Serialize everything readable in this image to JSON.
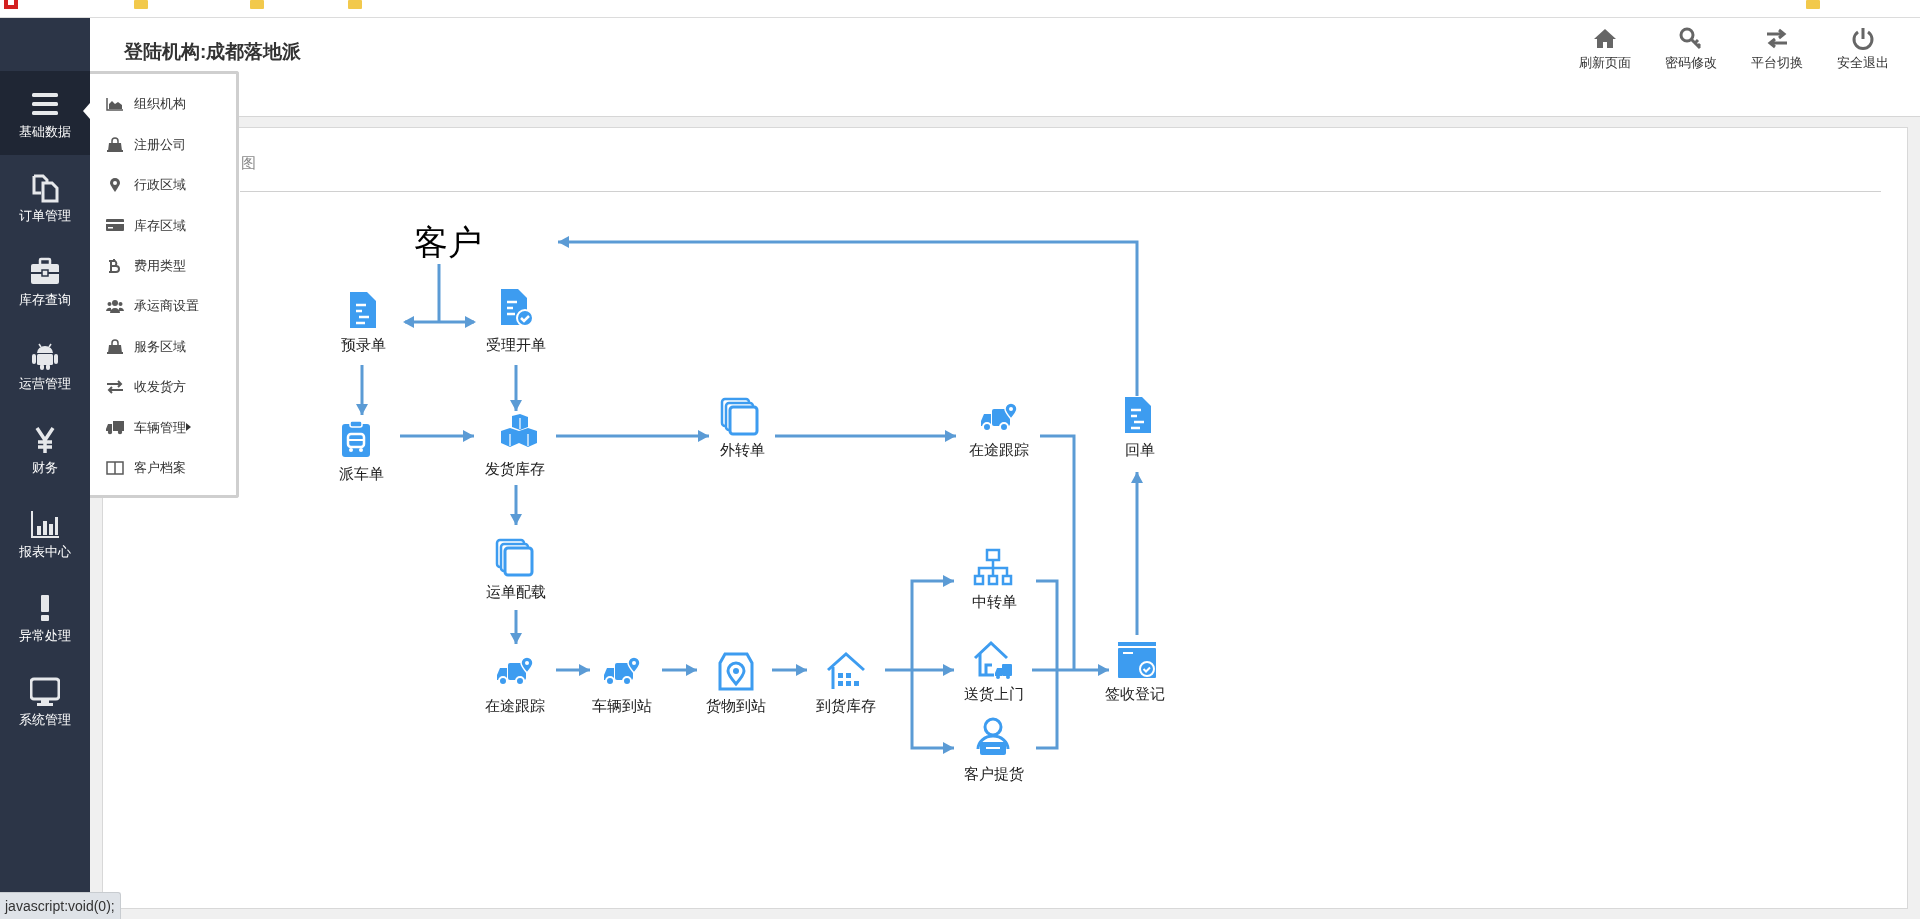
{
  "header": {
    "title": "登陆机构:成都落地派",
    "actions": [
      {
        "label": "刷新页面"
      },
      {
        "label": "密码修改"
      },
      {
        "label": "平台切换"
      },
      {
        "label": "安全退出"
      }
    ]
  },
  "sidebar": {
    "items": [
      {
        "label": "基础数据",
        "selected": true
      },
      {
        "label": "订单管理",
        "selected": false
      },
      {
        "label": "库存查询",
        "selected": false
      },
      {
        "label": "运营管理",
        "selected": false
      },
      {
        "label": "财务",
        "selected": false
      },
      {
        "label": "报表中心",
        "selected": false
      },
      {
        "label": "异常处理",
        "selected": false
      },
      {
        "label": "系统管理",
        "selected": false
      }
    ]
  },
  "menu": {
    "items": [
      {
        "label": "组织机构",
        "has_submenu": false
      },
      {
        "label": "注册公司",
        "has_submenu": false
      },
      {
        "label": "行政区域",
        "has_submenu": false
      },
      {
        "label": "库存区域",
        "has_submenu": false
      },
      {
        "label": "费用类型",
        "has_submenu": false
      },
      {
        "label": "承运商设置",
        "has_submenu": false
      },
      {
        "label": "服务区域",
        "has_submenu": false
      },
      {
        "label": "收发货方",
        "has_submenu": false
      },
      {
        "label": "车辆管理",
        "has_submenu": true
      },
      {
        "label": "客户档案",
        "has_submenu": false
      }
    ]
  },
  "panel": {
    "tab_title": "图"
  },
  "diagram": {
    "top_label": "客户",
    "nodes": [
      {
        "label": "预录单"
      },
      {
        "label": "受理开单"
      },
      {
        "label": "派车单"
      },
      {
        "label": "发货库存"
      },
      {
        "label": "外转单"
      },
      {
        "label": "在途跟踪"
      },
      {
        "label": "回单"
      },
      {
        "label": "运单配载"
      },
      {
        "label": "中转单"
      },
      {
        "label": "送货上门"
      },
      {
        "label": "签收登记"
      },
      {
        "label": "在途跟踪"
      },
      {
        "label": "车辆到站"
      },
      {
        "label": "货物到站"
      },
      {
        "label": "到货库存"
      },
      {
        "label": "客户提货"
      }
    ]
  },
  "status_bar": {
    "text": "javascript:void(0);"
  }
}
